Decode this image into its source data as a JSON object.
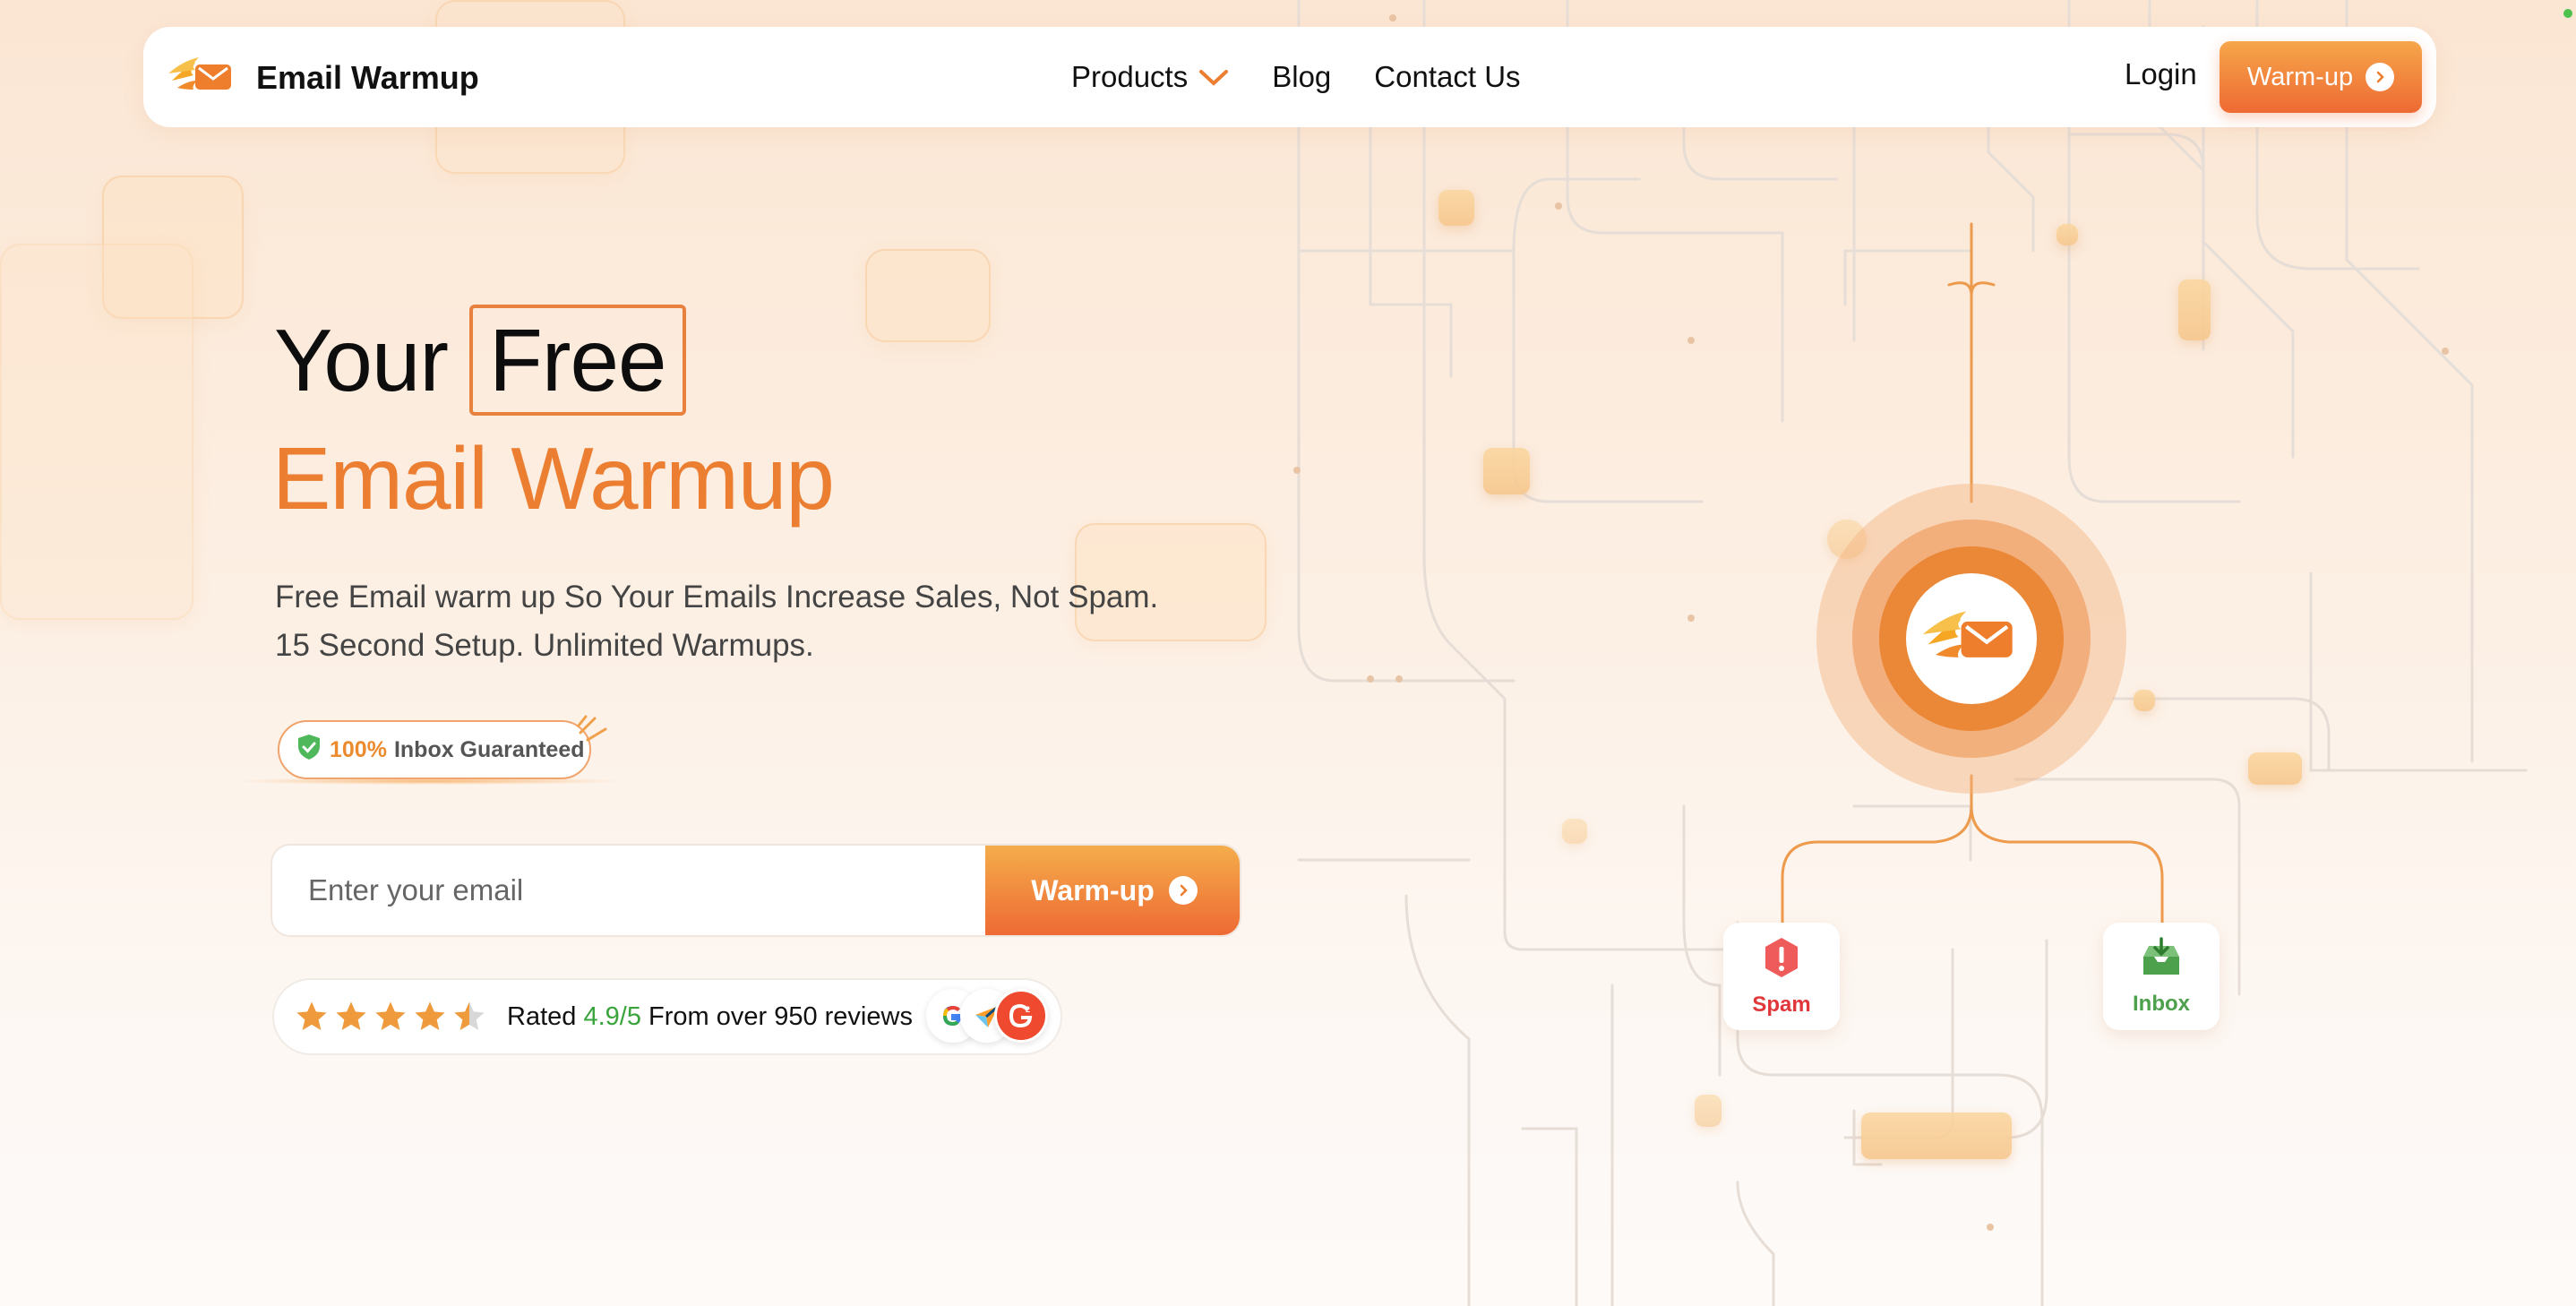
{
  "brand": {
    "name": "Email Warmup",
    "logo_icon": "flaming-envelope-icon"
  },
  "nav": {
    "links": [
      {
        "label": "Products",
        "has_dropdown": true
      },
      {
        "label": "Blog"
      },
      {
        "label": "Contact Us"
      }
    ],
    "login_label": "Login",
    "cta_label": "Warm-up"
  },
  "hero": {
    "title_word1": "Your",
    "title_highlight": "Free",
    "title_line2": "Email Warmup",
    "subtitle_line1": "Free Email warm up So Your Emails Increase Sales, Not Spam.",
    "subtitle_line2": "15 Second Setup. Unlimited Warmups.",
    "badge_percent": "100%",
    "badge_text": "Inbox Guaranteed"
  },
  "form": {
    "email_placeholder": "Enter your email",
    "email_value": "",
    "submit_label": "Warm-up"
  },
  "rating": {
    "stars": 4.5,
    "prefix": "Rated",
    "score": "4.9/5",
    "suffix": "From over 950 reviews",
    "review_sources": [
      "google-icon",
      "capterra-icon",
      "g2-icon"
    ]
  },
  "diagram": {
    "spam_label": "Spam",
    "inbox_label": "Inbox"
  },
  "colors": {
    "accent": "#ec7e32",
    "accent_gradient_top": "#f6a64a",
    "accent_gradient_bottom": "#ee6a34",
    "spam": "#e2373a",
    "inbox": "#4da14c",
    "rating_score": "#3aa43c"
  }
}
